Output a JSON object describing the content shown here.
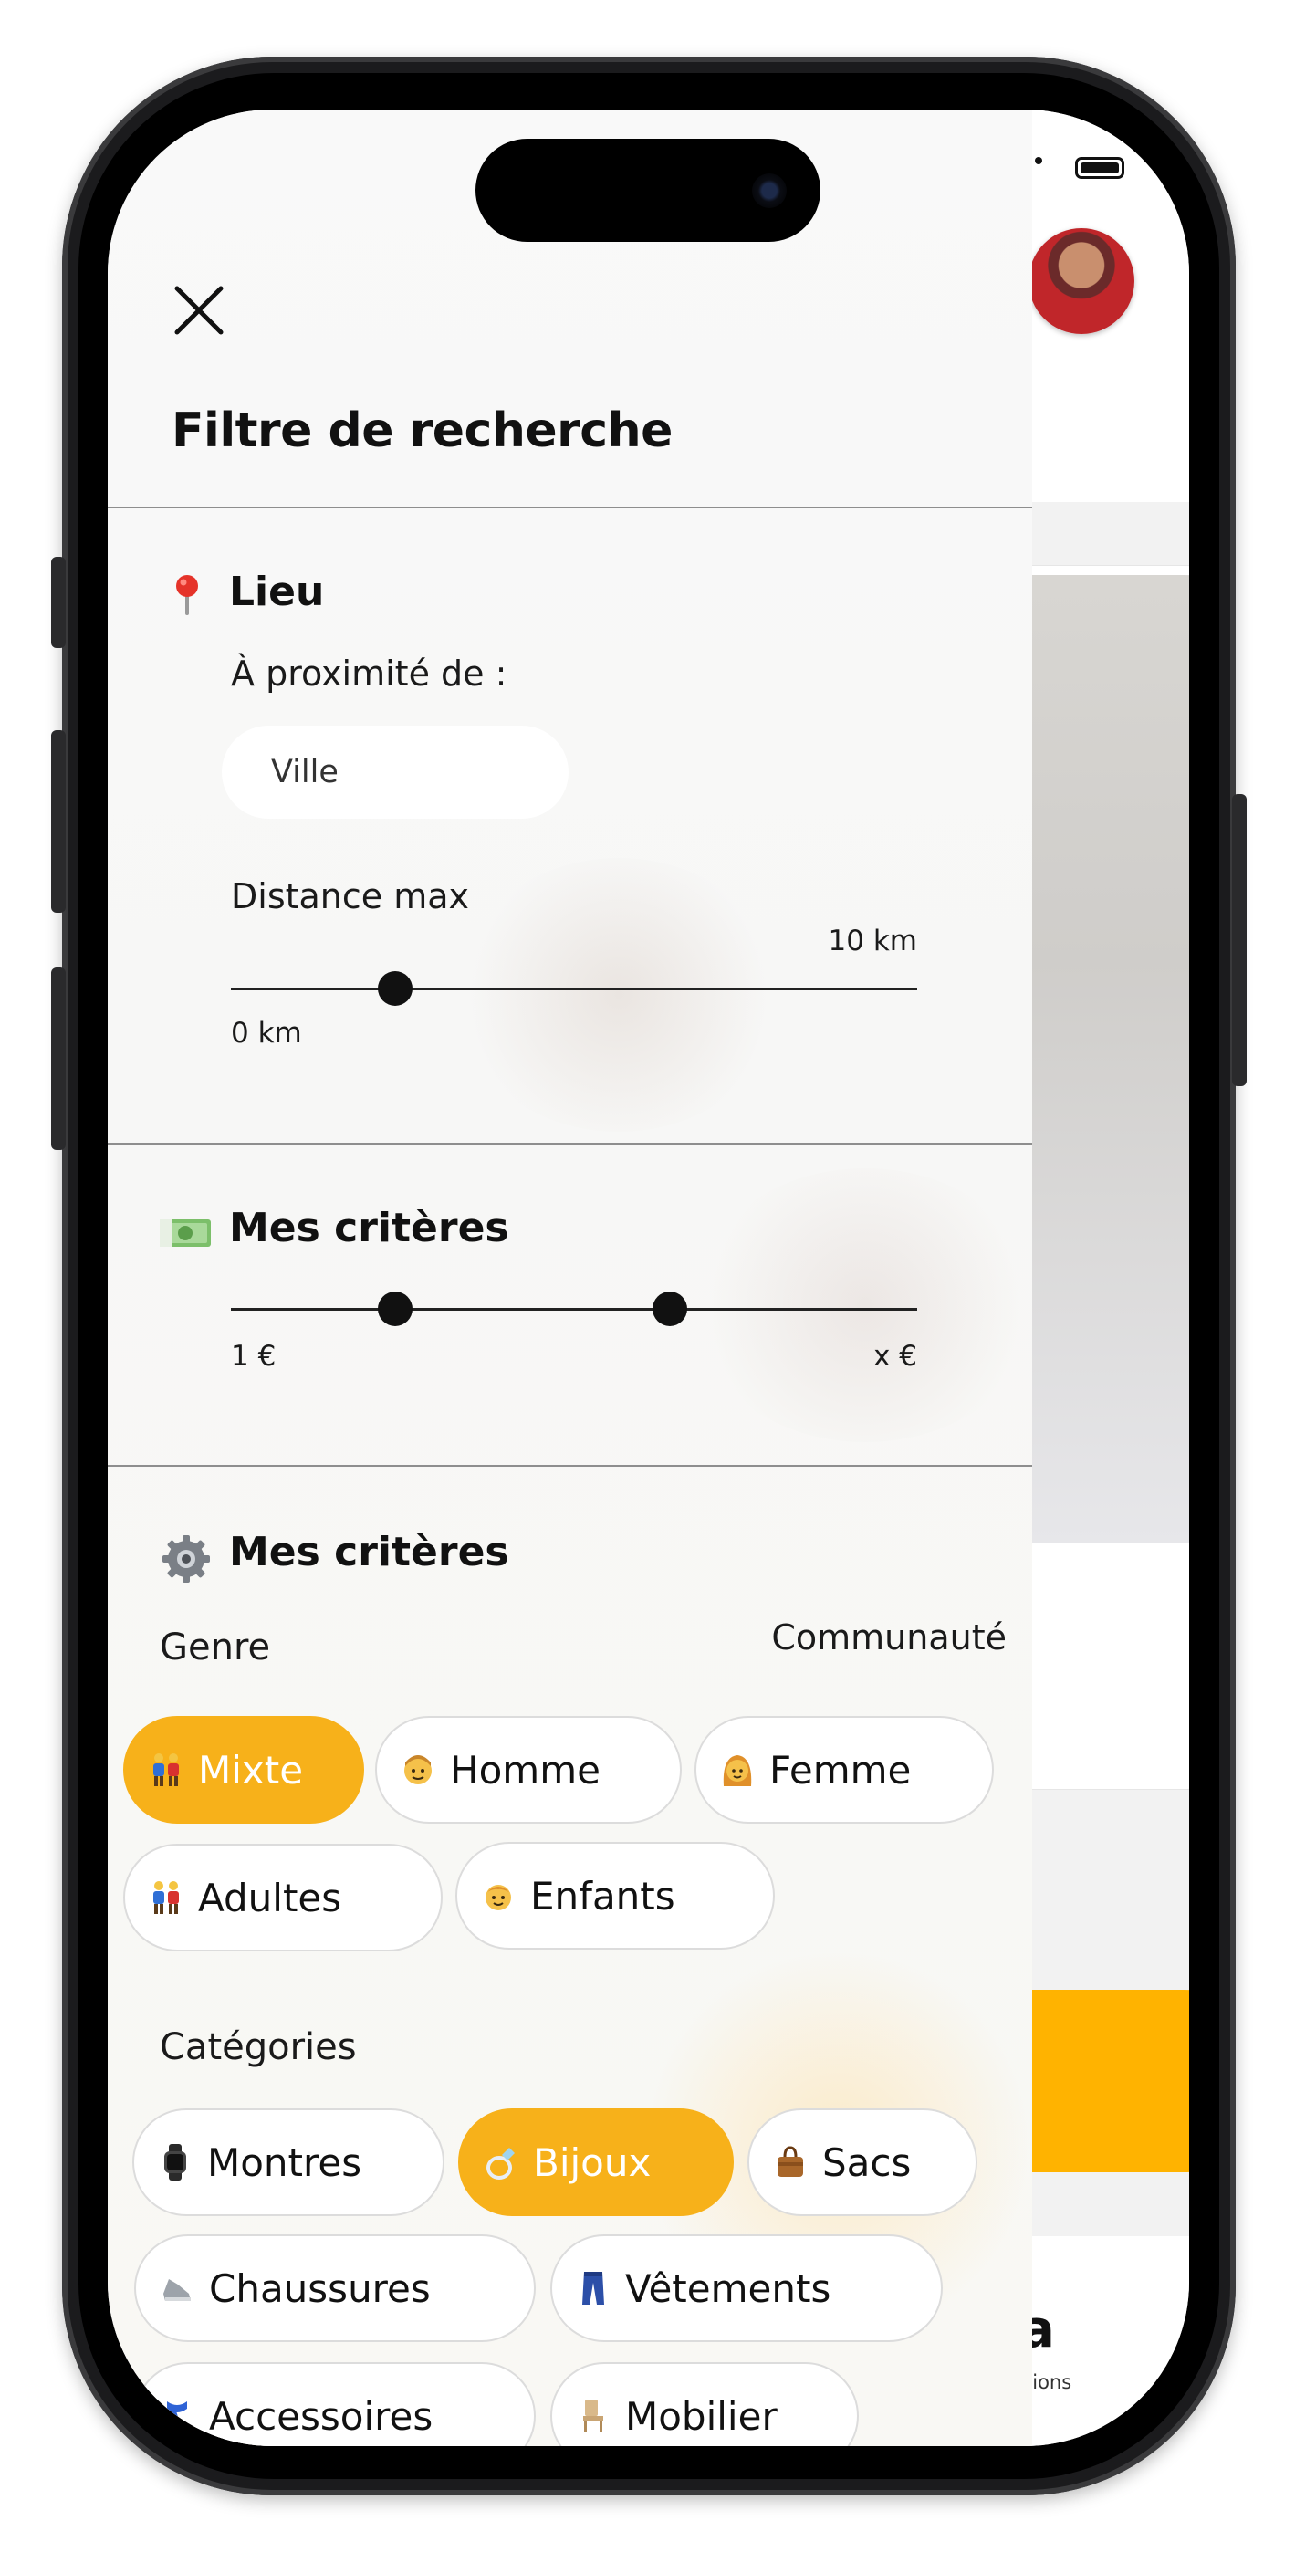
{
  "header": {
    "title": "Filtre de recherche",
    "close_icon": "close-icon"
  },
  "location": {
    "title": "Lieu",
    "icon": "pin-icon",
    "near_label": "À proximité de :",
    "city_placeholder": "Ville",
    "distance_label": "Distance max",
    "distance_min": "0 km",
    "distance_max": "10 km",
    "distance_value_fraction": 0.24
  },
  "price": {
    "title": "Mes critères",
    "icon": "money-icon",
    "min_label": "1 €",
    "max_label": "x €",
    "low_fraction": 0.24,
    "high_fraction": 0.64
  },
  "criteria": {
    "title": "Mes critères",
    "icon": "gear-icon",
    "genre_label": "Genre",
    "community_label": "Communauté",
    "genre_chips": [
      {
        "label": "Mixte",
        "icon": "couple-icon",
        "active": true
      },
      {
        "label": "Homme",
        "icon": "man-icon",
        "active": false
      },
      {
        "label": "Femme",
        "icon": "woman-icon",
        "active": false
      }
    ],
    "age_chips": [
      {
        "label": "Adultes",
        "icon": "couple-icon",
        "active": false
      },
      {
        "label": "Enfants",
        "icon": "child-icon",
        "active": false
      }
    ],
    "categories_label": "Catégories",
    "category_chips": [
      {
        "label": "Montres",
        "icon": "watch-icon",
        "active": false
      },
      {
        "label": "Bijoux",
        "icon": "ring-icon",
        "active": true
      },
      {
        "label": "Sacs",
        "icon": "bag-icon",
        "active": false
      },
      {
        "label": "Chaussures",
        "icon": "shoe-icon",
        "active": false
      },
      {
        "label": "Vêtements",
        "icon": "jeans-icon",
        "active": false
      },
      {
        "label": "Accessoires",
        "icon": "scarf-icon",
        "active": false
      },
      {
        "label": "Mobilier",
        "icon": "chair-icon",
        "active": false
      }
    ]
  },
  "background_app": {
    "partial_letter": "a",
    "partial_label": "tions",
    "accent_color": "#ffb300"
  },
  "colors": {
    "accent": "#f7b11a",
    "text": "#111111",
    "divider": "#8e8e8e"
  }
}
